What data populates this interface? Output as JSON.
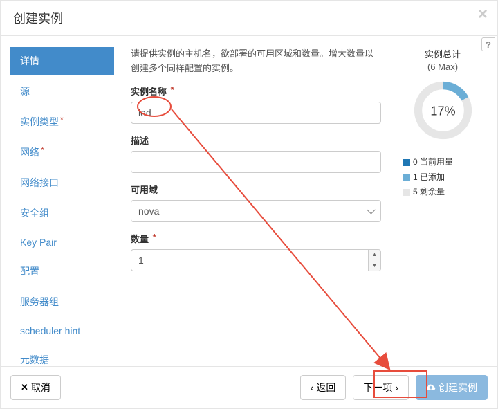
{
  "header": {
    "title": "创建实例",
    "close": "×"
  },
  "sidebar": {
    "items": [
      {
        "label": "详情",
        "required": false,
        "active": true
      },
      {
        "label": "源",
        "required": false,
        "active": false
      },
      {
        "label": "实例类型",
        "required": true,
        "active": false
      },
      {
        "label": "网络",
        "required": true,
        "active": false
      },
      {
        "label": "网络接口",
        "required": false,
        "active": false
      },
      {
        "label": "安全组",
        "required": false,
        "active": false
      },
      {
        "label": "Key Pair",
        "required": false,
        "active": false
      },
      {
        "label": "配置",
        "required": false,
        "active": false
      },
      {
        "label": "服务器组",
        "required": false,
        "active": false
      },
      {
        "label": "scheduler hint",
        "required": false,
        "active": false
      },
      {
        "label": "元数据",
        "required": false,
        "active": false
      }
    ]
  },
  "form": {
    "intro": "请提供实例的主机名，欲部署的可用区域和数量。增大数量以创建多个同样配置的实例。",
    "name_label": "实例名称",
    "name_value": "ied",
    "desc_label": "描述",
    "desc_value": "",
    "zone_label": "可用域",
    "zone_value": "nova",
    "count_label": "数量",
    "count_value": "1"
  },
  "stats": {
    "title": "实例总计",
    "sub": "(6 Max)",
    "percent": "17%",
    "legend": [
      {
        "color": "#1f77b4",
        "label": "0 当前用量"
      },
      {
        "color": "#6baed6",
        "label": "1 已添加"
      },
      {
        "color": "#e6e6e6",
        "label": "5 剩余量"
      }
    ]
  },
  "chart_data": {
    "type": "pie",
    "title": "实例总计",
    "max": 6,
    "percent_label": "17%",
    "series": [
      {
        "name": "当前用量",
        "value": 0,
        "color": "#1f77b4"
      },
      {
        "name": "已添加",
        "value": 1,
        "color": "#6baed6"
      },
      {
        "name": "剩余量",
        "value": 5,
        "color": "#e6e6e6"
      }
    ]
  },
  "footer": {
    "cancel": "取消",
    "back": "返回",
    "next": "下一项",
    "submit": "创建实例"
  },
  "help": "?"
}
